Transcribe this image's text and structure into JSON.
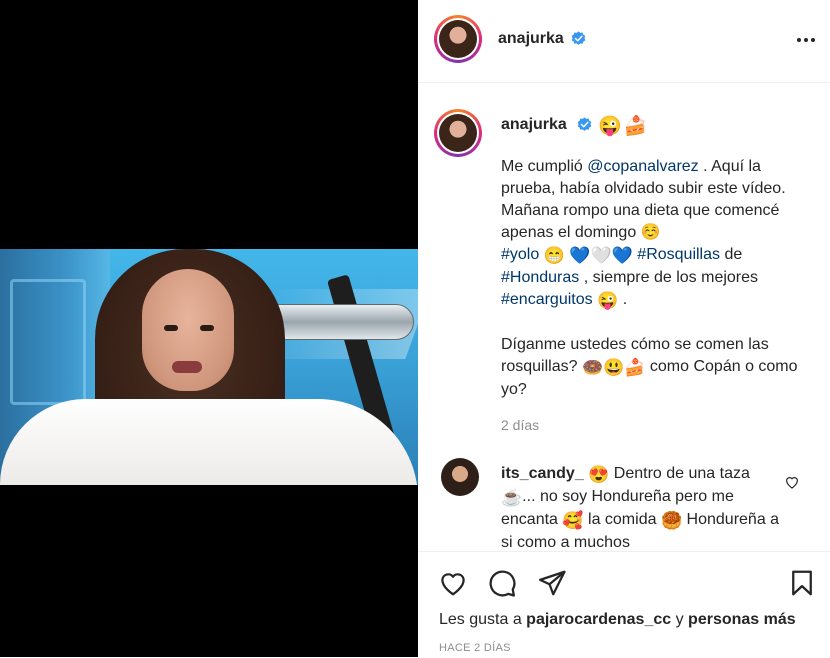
{
  "post": {
    "username": "anajurka",
    "verified": true
  },
  "caption": {
    "username": "anajurka",
    "header_emojis": "😜🍰",
    "line1_pre": "Me cumplió ",
    "mention": "@copanalvarez",
    "line1_post": " . Aquí la prueba, había olvidado subir este vídeo. Mañana rompo una dieta que comencé apenas el domingo ☺️",
    "tag_yolo": "#yolo",
    "emoji_yolo": "😁",
    "hearts": "💙🤍💙",
    "tag_rosquillas": "#Rosquillas",
    "text_de": " de",
    "tag_honduras": "#Honduras",
    "text_mejores": " , siempre de los mejores",
    "tag_encarguitos": "#encarguitos",
    "emoji_end": "😜",
    "text_period": " .",
    "para2_pre": "Díganme ustedes cómo se comen las rosquillas? ",
    "para2_emojis": "🍩😃🍰",
    "para2_post": " como Copán o como yo?",
    "time": "2 días"
  },
  "comment": {
    "username": "its_candy_",
    "emoji1": "😍",
    "text1": " Dentro de una taza ",
    "emoji2": "☕",
    "text2": "... no soy Hondureña pero me encanta ",
    "emoji3": "🥰",
    "text3": " la comida ",
    "emoji4": "🥮",
    "text4": " Hondureña a si como a muchos"
  },
  "likes": {
    "prefix": "Les gusta a ",
    "user": "pajarocardenas_cc",
    "middle": " y ",
    "others": "personas más"
  },
  "post_date": "HACE 2 DÍAS",
  "icons": {
    "verified": "verified-badge-icon",
    "more": "more-options-icon",
    "like": "heart-icon",
    "comment": "comment-bubble-icon",
    "share": "paper-plane-icon",
    "save": "bookmark-icon"
  },
  "colors": {
    "verified": "#3897f0",
    "link": "#00376b",
    "muted": "#8e8e8e",
    "text": "#262626"
  }
}
